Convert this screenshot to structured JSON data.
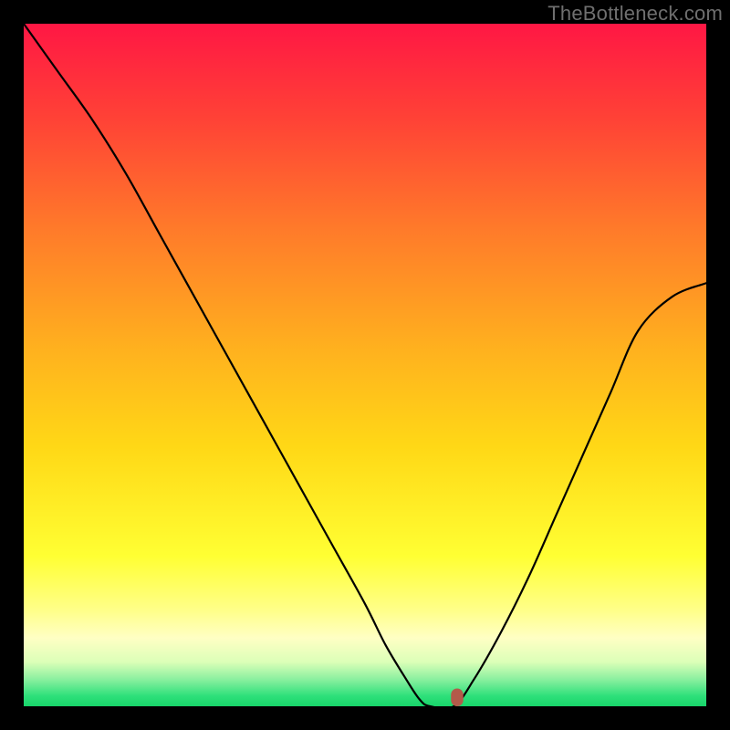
{
  "chart_data": {
    "type": "line",
    "watermark": "TheBottleneck.com",
    "title": "",
    "xlabel": "",
    "ylabel": "",
    "xlim": [
      0,
      100
    ],
    "ylim": [
      0,
      100
    ],
    "gradient_stops": [
      {
        "offset": 0.0,
        "color": "#ff1744"
      },
      {
        "offset": 0.14,
        "color": "#ff4236"
      },
      {
        "offset": 0.3,
        "color": "#ff7a2a"
      },
      {
        "offset": 0.48,
        "color": "#ffb21e"
      },
      {
        "offset": 0.62,
        "color": "#ffd816"
      },
      {
        "offset": 0.78,
        "color": "#ffff33"
      },
      {
        "offset": 0.86,
        "color": "#ffff8a"
      },
      {
        "offset": 0.9,
        "color": "#ffffc4"
      },
      {
        "offset": 0.935,
        "color": "#dcffb8"
      },
      {
        "offset": 0.96,
        "color": "#8cf0a0"
      },
      {
        "offset": 0.985,
        "color": "#2ee07a"
      },
      {
        "offset": 1.0,
        "color": "#18d46a"
      }
    ],
    "curve": {
      "x": [
        0,
        5,
        10,
        15,
        20,
        25,
        30,
        35,
        40,
        45,
        50,
        53,
        56,
        58,
        59.5,
        63,
        66,
        70,
        74,
        78,
        82,
        86,
        90,
        95,
        100
      ],
      "y": [
        100,
        93,
        86,
        78,
        69,
        60,
        51,
        42,
        33,
        24,
        15,
        9,
        4,
        1,
        0,
        0,
        4,
        11,
        19,
        28,
        37,
        46,
        55,
        60,
        62
      ]
    },
    "marker": {
      "x": 63.5,
      "y": 0,
      "color": "#b35a4a",
      "width": 1.8,
      "height": 2.6
    }
  }
}
